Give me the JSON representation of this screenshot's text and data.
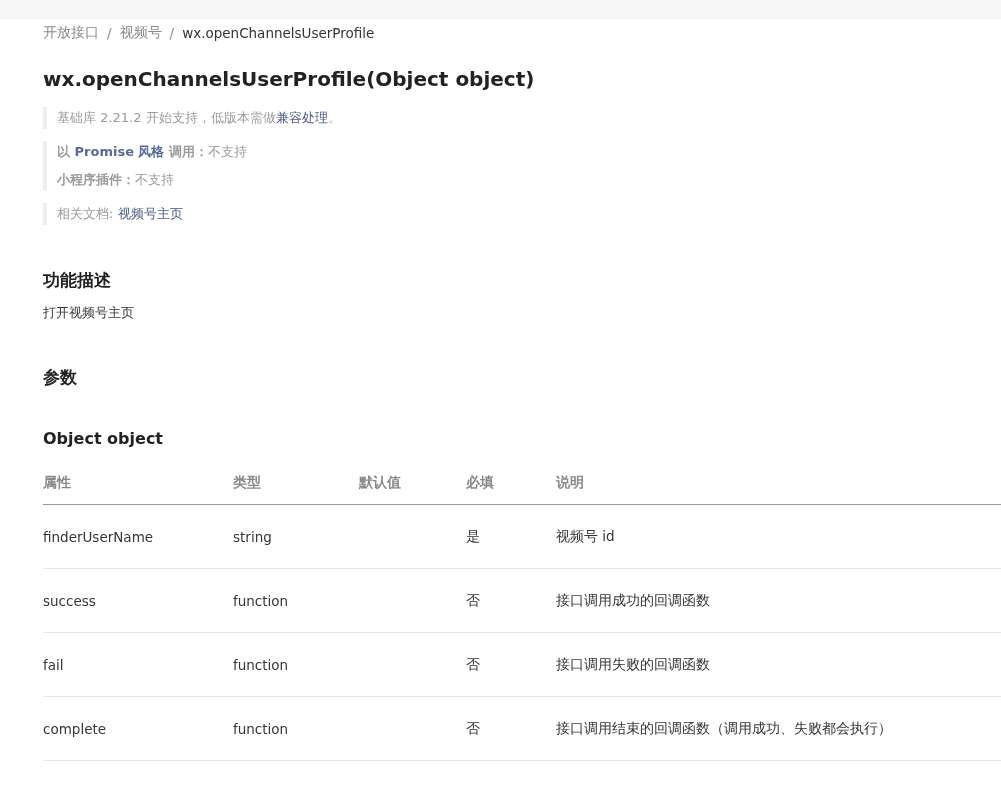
{
  "breadcrumb_separator": "/",
  "breadcrumb": [
    {
      "label": "开放接口",
      "current": false
    },
    {
      "label": "视频号",
      "current": false
    },
    {
      "label": "wx.openChannelsUserProfile",
      "current": true
    }
  ],
  "title": "wx.openChannelsUserProfile(Object object)",
  "notes": [
    {
      "lines": [
        [
          {
            "kind": "text",
            "text": "基础库 2.21.2 开始支持，低版本需做"
          },
          {
            "kind": "link",
            "text": "兼容处理"
          },
          {
            "kind": "text",
            "text": "。"
          }
        ]
      ]
    },
    {
      "lines": [
        [
          {
            "kind": "strong",
            "text": "以 "
          },
          {
            "kind": "link-strong",
            "text": "Promise 风格"
          },
          {
            "kind": "strong",
            "text": " 调用："
          },
          {
            "kind": "text",
            "text": "不支持"
          }
        ],
        [
          {
            "kind": "strong",
            "text": "小程序插件："
          },
          {
            "kind": "text",
            "text": "不支持"
          }
        ]
      ]
    },
    {
      "lines": [
        [
          {
            "kind": "text",
            "text": "相关文档: "
          },
          {
            "kind": "link",
            "text": "视频号主页"
          }
        ]
      ]
    }
  ],
  "sections": [
    {
      "heading": "功能描述",
      "body": "打开视频号主页"
    },
    {
      "heading": "参数"
    }
  ],
  "param_title": "Object object",
  "table": {
    "columns": [
      "属性",
      "类型",
      "默认值",
      "必填",
      "说明"
    ],
    "rows": [
      [
        "finderUserName",
        "string",
        "",
        "是",
        "视频号 id"
      ],
      [
        "success",
        "function",
        "",
        "否",
        "接口调用成功的回调函数"
      ],
      [
        "fail",
        "function",
        "",
        "否",
        "接口调用失败的回调函数"
      ],
      [
        "complete",
        "function",
        "",
        "否",
        "接口调用结束的回调函数（调用成功、失败都会执行）"
      ]
    ]
  }
}
